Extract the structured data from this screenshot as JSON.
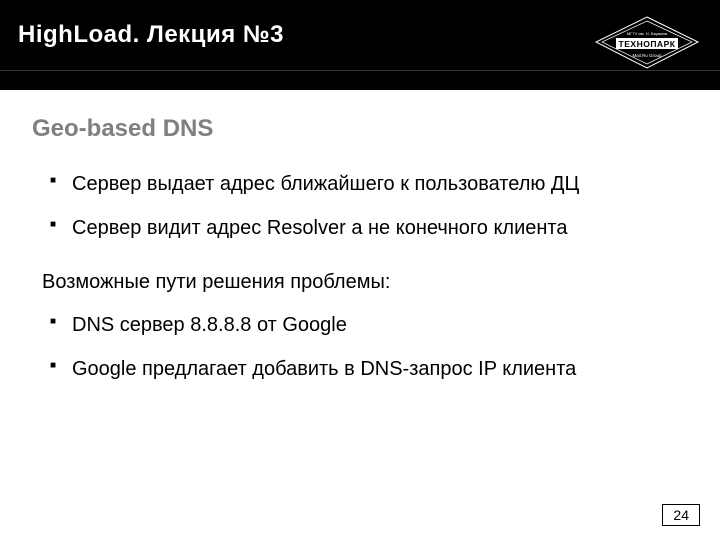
{
  "header": {
    "title": "HighLoad. Лекция №3",
    "logo_top": "МГТУ им. Н. Баумана",
    "logo_mid": "ТЕХНОПАРК",
    "logo_bottom": "Mail.Ru Group"
  },
  "section_title": "Geo-based DNS",
  "bullets_a": [
    "Сервер выдает адрес ближайшего к пользователю ДЦ",
    "Сервер видит адрес Resolver а не конечного клиента"
  ],
  "paragraph": "Возможные пути решения проблемы:",
  "bullets_b": [
    "DNS сервер 8.8.8.8 от Google",
    "Google предлагает добавить в DNS-запрос IP клиента"
  ],
  "page_number": "24"
}
